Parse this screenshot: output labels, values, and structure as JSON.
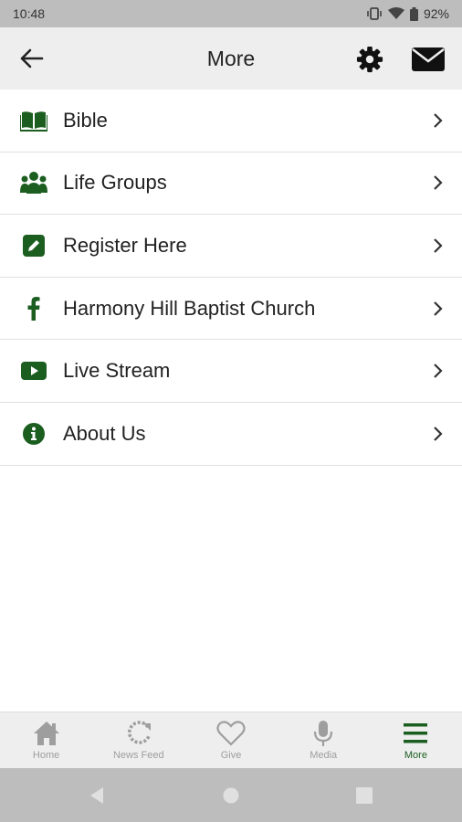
{
  "status_bar": {
    "time": "10:48",
    "battery": "92%"
  },
  "header": {
    "title": "More",
    "back_icon": "arrow-left-icon",
    "settings_icon": "gear-icon",
    "mail_icon": "envelope-icon"
  },
  "menu": {
    "items": [
      {
        "label": "Bible",
        "icon": "book-icon"
      },
      {
        "label": "Life Groups",
        "icon": "users-icon"
      },
      {
        "label": "Register Here",
        "icon": "edit-icon"
      },
      {
        "label": "Harmony Hill Baptist Church",
        "icon": "facebook-icon"
      },
      {
        "label": "Live Stream",
        "icon": "youtube-icon"
      },
      {
        "label": "About Us",
        "icon": "info-icon"
      }
    ]
  },
  "tab_bar": {
    "tabs": [
      {
        "label": "Home",
        "icon": "home-icon",
        "active": false
      },
      {
        "label": "News Feed",
        "icon": "refresh-icon",
        "active": false
      },
      {
        "label": "Give",
        "icon": "heart-icon",
        "active": false
      },
      {
        "label": "Media",
        "icon": "microphone-icon",
        "active": false
      },
      {
        "label": "More",
        "icon": "menu-icon",
        "active": true
      }
    ]
  },
  "colors": {
    "accent": "#1b5e20",
    "inactive": "#9e9e9e",
    "header_bg": "#eeeeee",
    "status_bg": "#bdbdbd"
  }
}
